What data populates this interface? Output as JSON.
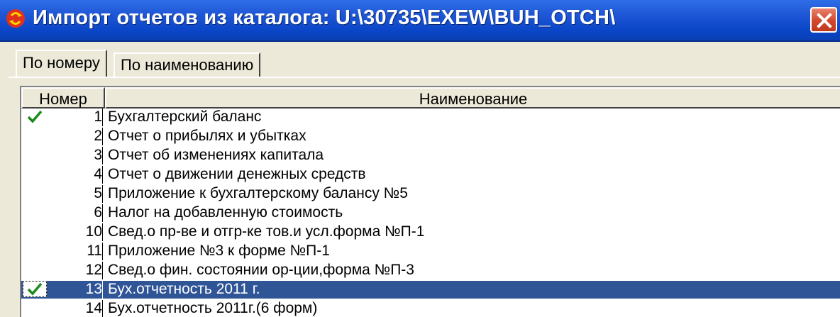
{
  "window": {
    "title": "Импорт отчетов из каталога:  U:\\30735\\EXEW\\BUH_OTCH\\",
    "icon": "recycle-app-icon",
    "close_icon": "close-icon"
  },
  "tabs": [
    {
      "label": "По номеру",
      "active": true
    },
    {
      "label": "По наименованию",
      "active": false
    }
  ],
  "grid": {
    "columns": [
      "Номер",
      "Наименование"
    ],
    "rows": [
      {
        "num": "1",
        "name": "Бухгалтерский баланс",
        "checked": true,
        "selected": false
      },
      {
        "num": "2",
        "name": "Отчет о прибылях и убытках",
        "checked": false,
        "selected": false
      },
      {
        "num": "3",
        "name": "Отчет об изменениях капитала",
        "checked": false,
        "selected": false
      },
      {
        "num": "4",
        "name": "Отчет о движении денежных средств",
        "checked": false,
        "selected": false
      },
      {
        "num": "5",
        "name": "Приложение к бухгалтерскому балансу №5",
        "checked": false,
        "selected": false
      },
      {
        "num": "6",
        "name": "Налог на добавленную стоимость",
        "checked": false,
        "selected": false
      },
      {
        "num": "10",
        "name": "Свед.о пр-ве и отгр-ке тов.и усл.форма №П-1",
        "checked": false,
        "selected": false
      },
      {
        "num": "11",
        "name": "Приложение №3 к форме №П-1",
        "checked": false,
        "selected": false
      },
      {
        "num": "12",
        "name": "Свед.о фин. состоянии ор-ции,форма №П-3",
        "checked": false,
        "selected": false
      },
      {
        "num": "13",
        "name": "Бух.отчетность 2011 г.",
        "checked": true,
        "selected": true
      },
      {
        "num": "14",
        "name": "Бух.отчетность 2011г.(6 форм)",
        "checked": false,
        "selected": false
      }
    ]
  },
  "colors": {
    "titlebar": "#0a46c8",
    "selection": "#2f5597",
    "check": "#1a8a1a",
    "close": "#d2462c"
  }
}
